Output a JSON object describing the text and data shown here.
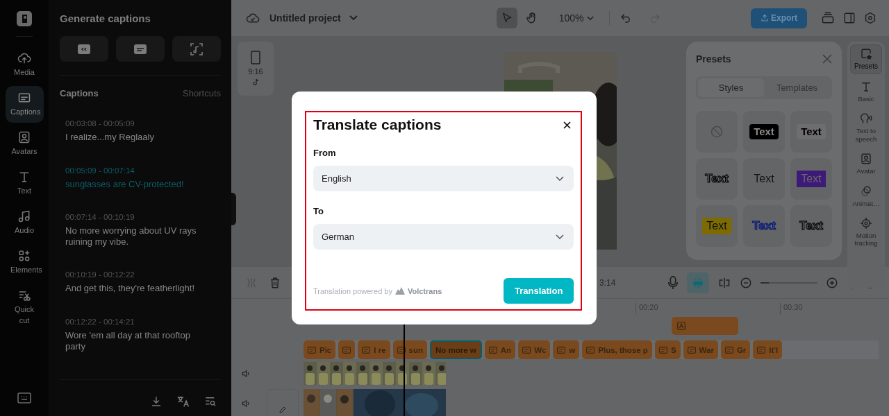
{
  "sidebar": {
    "items": [
      {
        "label": "Media",
        "selected": false
      },
      {
        "label": "Captions",
        "selected": true
      },
      {
        "label": "Avatars",
        "selected": false
      },
      {
        "label": "Text",
        "selected": false
      },
      {
        "label": "Audio",
        "selected": false
      },
      {
        "label": "Elements",
        "selected": false
      },
      {
        "label": "Quick cut",
        "selected": false
      }
    ]
  },
  "captions_panel": {
    "title": "Generate captions",
    "heading": "Captions",
    "shortcuts": "Shortcuts",
    "captions": [
      {
        "time": "00:03:08 - 00:05:09",
        "text": "I realize...my Reglaaly",
        "selected": false
      },
      {
        "time": "00:05:09 - 00:07:14",
        "text": "sunglasses are CV-protected!",
        "selected": true
      },
      {
        "time": "00:07:14 - 00:10:19",
        "text": "No more worrying about UV rays ruining my vibe.",
        "selected": false
      },
      {
        "time": "00:10:19 - 00:12:22",
        "text": "And get this, they're featherlight!",
        "selected": false
      },
      {
        "time": "00:12:22 - 00:14:21",
        "text": "Wore 'em all day at that rooftop party",
        "selected": false
      }
    ]
  },
  "toolbar": {
    "project": "Untitled project",
    "tools": [
      {
        "kind": "pointer",
        "selected": true
      },
      {
        "kind": "hand",
        "selected": false
      }
    ],
    "zoom": "100%",
    "history": [
      {
        "kind": "undo",
        "disabled": false
      },
      {
        "kind": "redo",
        "disabled": true
      }
    ],
    "export": "Export"
  },
  "aspect": {
    "ratio": "9:16"
  },
  "presets": {
    "title": "Presets",
    "tabs": [
      {
        "label": "Styles",
        "selected": true
      },
      {
        "label": "Templates",
        "selected": false
      }
    ],
    "styles": [
      {
        "kind": "none"
      },
      {
        "kind": "dark-box",
        "label": "Text"
      },
      {
        "kind": "light-box",
        "label": "Text"
      },
      {
        "kind": "outline",
        "label": "Text"
      },
      {
        "kind": "plain",
        "label": "Text"
      },
      {
        "kind": "purple-box",
        "label": "Text"
      },
      {
        "kind": "yellow-box",
        "label": "Text"
      },
      {
        "kind": "blue-outline",
        "label": "Text"
      },
      {
        "kind": "dark-outline",
        "label": "Text"
      }
    ]
  },
  "right_rail": {
    "items": [
      {
        "label": "Presets",
        "selected": true
      },
      {
        "label": "Basic",
        "selected": false
      },
      {
        "label": "Text to speech",
        "selected": false
      },
      {
        "label": "Avatar",
        "selected": false
      },
      {
        "label": "Animat…",
        "selected": false
      },
      {
        "label": "Motion tracking",
        "selected": false
      }
    ]
  },
  "timeline": {
    "time": "3:14",
    "zoom_slider": {
      "level": 0.15
    },
    "ruler": [
      "00:20",
      "00:30"
    ],
    "caption_clips": [
      {
        "label": "Pic",
        "selected": false
      },
      {
        "selected": false
      },
      {
        "label": "I re",
        "selected": false
      },
      {
        "label": "sun",
        "selected": false
      },
      {
        "label": "No more w",
        "selected": true
      },
      {
        "label": "An",
        "selected": false
      },
      {
        "label": "Wc",
        "selected": false
      },
      {
        "label": "w",
        "selected": false
      },
      {
        "label": "Plus, those p",
        "selected": false
      },
      {
        "label": "S",
        "selected": false
      },
      {
        "label": "War",
        "selected": false
      },
      {
        "label": "Gr",
        "selected": false
      },
      {
        "label": "It'l",
        "selected": false
      }
    ]
  },
  "dialog": {
    "title": "Translate captions",
    "from_label": "From",
    "from_value": "English",
    "to_label": "To",
    "to_value": "German",
    "powered_by": "Translation powered by",
    "brand": "Volctrans",
    "button": "Translation"
  }
}
